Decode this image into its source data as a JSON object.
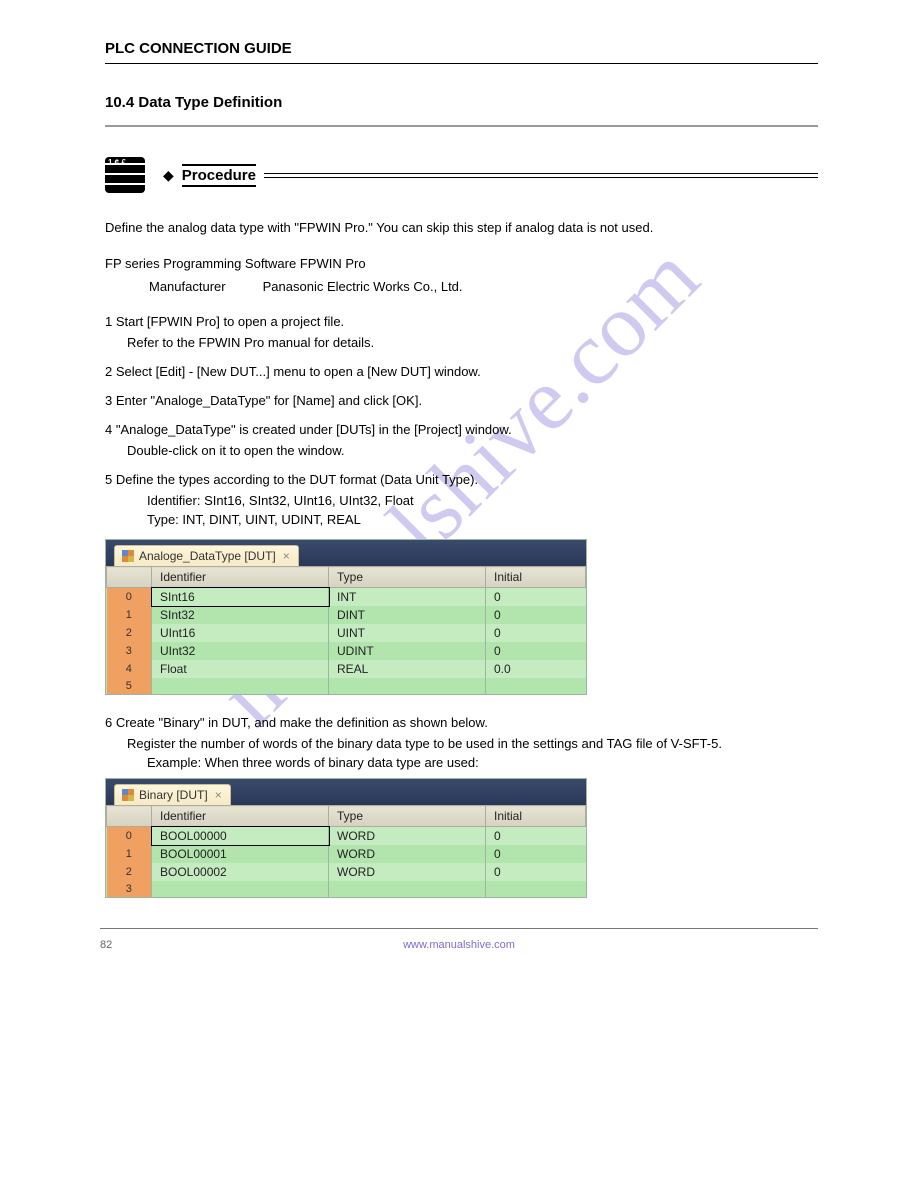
{
  "header": {
    "title": "PLC CONNECTION GUIDE"
  },
  "section_heading": "10.4 Data Type Definition",
  "procedure": {
    "label": "Procedure",
    "intro": "Define the analog data type with \"FPWIN Pro.\" You can skip this step if analog data is not used.",
    "software_title": "FP series Programming Software FPWIN Pro",
    "manufacturer_label": "Manufacturer",
    "manufacturer_value": "Panasonic Electric Works Co., Ltd.",
    "steps": {
      "s1_a": "1   Start [FPWIN Pro] to open a project file.",
      "s1_b": "Refer to the FPWIN Pro manual for details.",
      "s2": "2   Select [Edit] - [New DUT...] menu to open a [New DUT] window.",
      "s3": "3   Enter \"Analoge_DataType\" for [Name] and click [OK].",
      "s4_a": "4   \"Analoge_DataType\" is created under [DUTs] in the [Project] window.",
      "s4_b": "Double-click on it to open the window.",
      "s5_a": "5   Define the types according to the DUT format (Data Unit Type).",
      "s5_b": "Identifier:   SInt16, SInt32, UInt16, UInt32, Float",
      "s5_c": "Type:       INT, DINT, UINT, UDINT, REAL",
      "s6_a": "6   Create \"Binary\" in DUT, and make the definition as shown below.",
      "s6_b": "Register the number of words of the binary data type to be used in the settings and TAG file of V-SFT-5.",
      "s6_c": "Example: When three words of binary data type are used:"
    }
  },
  "panel1": {
    "tab": "Analoge_DataType [DUT]",
    "columns": [
      "",
      "Identifier",
      "Type",
      "Initial"
    ],
    "rows": [
      {
        "n": "0",
        "id": "SInt16",
        "type": "INT",
        "init": "0"
      },
      {
        "n": "1",
        "id": "SInt32",
        "type": "DINT",
        "init": "0"
      },
      {
        "n": "2",
        "id": "UInt16",
        "type": "UINT",
        "init": "0"
      },
      {
        "n": "3",
        "id": "UInt32",
        "type": "UDINT",
        "init": "0"
      },
      {
        "n": "4",
        "id": "Float",
        "type": "REAL",
        "init": "0.0"
      },
      {
        "n": "5",
        "id": "",
        "type": "",
        "init": ""
      }
    ]
  },
  "panel2": {
    "tab": "Binary [DUT]",
    "columns": [
      "",
      "Identifier",
      "Type",
      "Initial"
    ],
    "rows": [
      {
        "n": "0",
        "id": "BOOL00000",
        "type": "WORD",
        "init": "0"
      },
      {
        "n": "1",
        "id": "BOOL00001",
        "type": "WORD",
        "init": "0"
      },
      {
        "n": "2",
        "id": "BOOL00002",
        "type": "WORD",
        "init": "0"
      },
      {
        "n": "3",
        "id": "",
        "type": "",
        "init": ""
      }
    ]
  },
  "footer": {
    "page": "82",
    "site": "www.manualshive.com"
  }
}
